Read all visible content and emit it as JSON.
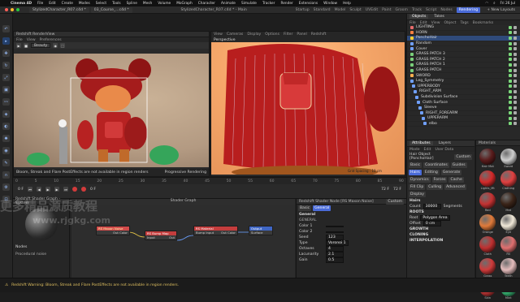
{
  "mac_menu": {
    "app": "Cinema 4D",
    "items": [
      "File",
      "Edit",
      "Create",
      "Modes",
      "Select",
      "Tools",
      "Spline",
      "Mesh",
      "Volume",
      "MoGraph",
      "Character",
      "Animate",
      "Simulate",
      "Tracker",
      "Render",
      "Extensions",
      "Window",
      "Help"
    ],
    "clock": "Fri 26 Jul"
  },
  "window": {
    "tabs": [
      "StylizedCharacter_R07.c4d *",
      "03_Course_...c4d *"
    ],
    "title": "StylizedCharacter_R07.c4d * - Main",
    "layouts": [
      "Startup",
      "Standard",
      "Model",
      "Sculpt",
      "UVEdit",
      "Paint",
      "Groom",
      "Track",
      "Script",
      "Nodes",
      "Rendering"
    ],
    "active_layout": "Rendering",
    "new_layout": "+ New Layouts"
  },
  "render_view": {
    "title": "Redshift RenderView",
    "menu": [
      "File",
      "View",
      "Preferences"
    ],
    "mode": "Beauty",
    "status": "Bloom, Streak and Flare PostEffects are not available in region renders",
    "progress": "Progressive Rendering"
  },
  "viewport": {
    "menu": [
      "View",
      "Cameras",
      "Display",
      "Options",
      "Filter",
      "Panel",
      "Redshift"
    ],
    "label": "Perspective",
    "status": "Grid Spacing : 10 cm"
  },
  "object_manager": {
    "tabs": [
      "Objects",
      "Takes"
    ],
    "menu": [
      "File",
      "Edit",
      "View",
      "Object",
      "Tags",
      "Bookmarks"
    ],
    "objects": [
      {
        "name": "LIGHTING",
        "color": "#e86a6a"
      },
      {
        "name": "HORN",
        "color": "#ff8040"
      },
      {
        "name": "PonchoHair",
        "color": "#ffd030",
        "selected": true
      },
      {
        "name": "Random",
        "color": "#70a0ff"
      },
      {
        "name": "Cover",
        "color": "#70a0ff"
      },
      {
        "name": "GRASS PATCH 3",
        "color": "#7ad07a"
      },
      {
        "name": "GRASS PATCH 2",
        "color": "#7ad07a"
      },
      {
        "name": "GRASS PATCH 1",
        "color": "#7ad07a"
      },
      {
        "name": "GRASS PATCH",
        "color": "#7ad07a"
      },
      {
        "name": "SWORD",
        "color": "#ffb050"
      },
      {
        "name": "Leg_Symmetry",
        "color": "#70a0ff"
      },
      {
        "name": "UPPERBODY",
        "color": "#70a0ff"
      },
      {
        "name": "RIGHT_ARM",
        "color": "#70a0ff"
      },
      {
        "name": "Subdivision Surface",
        "color": "#70a0ff"
      },
      {
        "name": "Cloth Surface",
        "color": "#70a0ff"
      },
      {
        "name": "Sleeve",
        "color": "#70a0ff"
      },
      {
        "name": "RIGHT_FOREARM",
        "color": "#70a0ff"
      },
      {
        "name": "UPPERARM",
        "color": "#70a0ff"
      },
      {
        "name": "elbo",
        "color": "#70a0ff"
      }
    ]
  },
  "attributes": {
    "tabs": [
      "Attributes",
      "Layers"
    ],
    "menu": [
      "Mode",
      "Edit",
      "User Data"
    ],
    "object": "Hair Object [PonchoHair]",
    "mode": "Custom",
    "buttons_row1": [
      "Basic",
      "Coordinates",
      "Guides",
      "Hairs"
    ],
    "buttons_row2": [
      "Editing",
      "Generate",
      "Dynamics"
    ],
    "buttons_row3": [
      "Forces",
      "Cache",
      "Fill Clip",
      "Culling"
    ],
    "buttons_row4": [
      "Advanced",
      "Display"
    ],
    "active": "Hairs",
    "section": "Hairs",
    "count_label": "Count",
    "count": "30000",
    "segments_label": "Segments",
    "roots": "ROOTS",
    "root_label": "Root",
    "root_value": "Polygon Area",
    "offset_label": "Offset",
    "offset_value": "0 cm",
    "growth": "GROWTH",
    "cloning": "CLONING",
    "interpolation": "INTERPOLATION"
  },
  "materials": {
    "title": "Materials",
    "items": [
      {
        "name": "Hair Mat",
        "color": "#5a1c1c"
      },
      {
        "name": "Sword",
        "color": "#cfcfcf"
      },
      {
        "name": "Lights_Mt",
        "color": "#d42a2a"
      },
      {
        "name": "Clothing",
        "color": "#e04040"
      },
      {
        "name": "Red",
        "color": "#c43232"
      },
      {
        "name": "Mat",
        "color": "#3a2418"
      },
      {
        "name": "Orange",
        "color": "#e07a3a"
      },
      {
        "name": "Eye",
        "color": "#f0e8d8"
      },
      {
        "name": "Cloth",
        "color": "#c03030"
      },
      {
        "name": "Fill",
        "color": "#e07070"
      },
      {
        "name": "Grass",
        "color": "#d03b3b"
      },
      {
        "name": "Teeth",
        "color": "#e4bcbc"
      },
      {
        "name": "Skin",
        "color": "#c83838"
      },
      {
        "name": "Mint",
        "color": "#3ac07a"
      }
    ]
  },
  "timeline": {
    "ticks": [
      "0",
      "5",
      "10",
      "15",
      "20",
      "25",
      "30",
      "35",
      "40",
      "45",
      "50",
      "55",
      "60",
      "65",
      "70",
      "75",
      "80",
      "85",
      "90"
    ],
    "start": "0 F",
    "end": "72 F",
    "current": "0 F",
    "fps": "72 F"
  },
  "shader_graph": {
    "title": "Redshift Shader Graph - System",
    "graph_label": "Shader Graph",
    "nodes": [
      {
        "title": "RS Maxon Noise",
        "ports": [
          "Out Color"
        ]
      },
      {
        "title": "RS Bump Map",
        "ports": [
          "Input",
          "Out"
        ]
      },
      {
        "title": "RS Material",
        "ports": [
          "Bump Input",
          "Out Color"
        ]
      },
      {
        "title": "Output",
        "ports": [
          "Surface"
        ]
      }
    ],
    "left_items": [
      "Nodes",
      "Procedural noise"
    ]
  },
  "node_props": {
    "title": "Redshift Shader Node [RS Maxon Noise]",
    "mode": "Custom",
    "tabs": [
      "Basic",
      "General"
    ],
    "section": "General",
    "sub": "GENERAL",
    "fields": [
      {
        "label": "Color 1",
        "value": ""
      },
      {
        "label": "Color 2",
        "value": ""
      },
      {
        "label": "Seed",
        "value": "123"
      },
      {
        "label": "Type",
        "value": "Voronoi 1"
      },
      {
        "label": "Octaves",
        "value": "4"
      },
      {
        "label": "Lacunarity",
        "value": "2.1"
      },
      {
        "label": "Gain",
        "value": "0.5"
      }
    ]
  },
  "statusbar": {
    "text": "Redshift Warning: Bloom, Streak and Flare PostEffects are not available in region renders."
  },
  "watermark": {
    "line1": "更多精品源质教程",
    "line2": "www.rjgkg.com"
  }
}
